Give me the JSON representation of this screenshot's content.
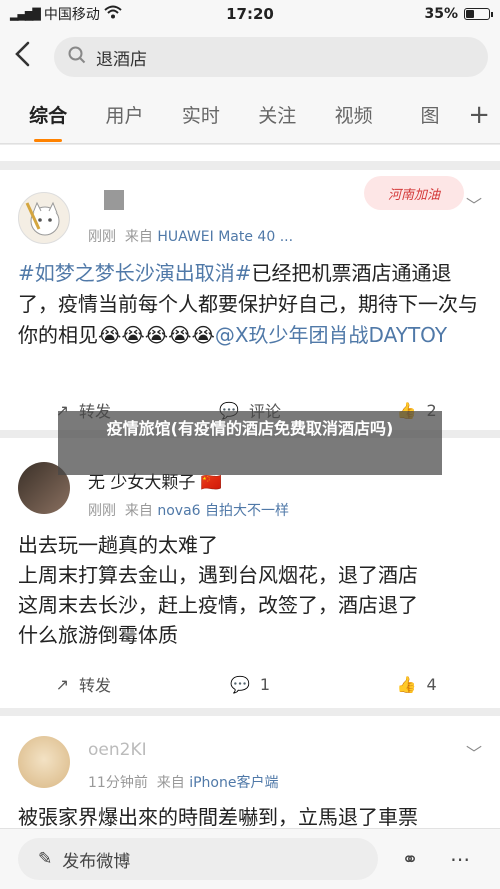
{
  "status_bar": {
    "carrier": "中国移动",
    "time": "17:20",
    "battery": "35%",
    "battery_level": 0.35
  },
  "search": {
    "query": "退酒店"
  },
  "tabs": [
    {
      "label": "综合",
      "active": true
    },
    {
      "label": "用户",
      "active": false
    },
    {
      "label": "实时",
      "active": false
    },
    {
      "label": "关注",
      "active": false
    },
    {
      "label": "视频",
      "active": false
    },
    {
      "label": "图",
      "active": false
    }
  ],
  "posts": [
    {
      "time": "刚刚",
      "source_prefix": "来自",
      "source": "HUAWEI Mate 40 ...",
      "topic": "#如梦之梦长沙演出取消#",
      "text": "已经把机票酒店通通退了，疫情当前每个人都要保护好自己，期待下一次与你的相见",
      "emoji": "😭😭😭😭😭",
      "mention": "@X玖少年团肖战DAYTOY",
      "badge": "河南加油",
      "repost": "转发",
      "comment": "评论",
      "like": "2"
    },
    {
      "username": "无 少女大颗子",
      "flag": "🇨🇳",
      "time": "刚刚",
      "source_prefix": "来自",
      "source": "nova6 自拍大不一样",
      "lines": [
        "出去玩一趟真的太难了",
        "上周末打算去金山，遇到台风烟花，退了酒店",
        "这周末去长沙，赶上疫情，改签了，酒店退了",
        "什么旅游倒霉体质"
      ],
      "repost": "转发",
      "comment": "1",
      "like": "4"
    },
    {
      "username": "oen2KI",
      "time": "11分钟前",
      "source_prefix": "来自",
      "source": "iPhone客户端",
      "text": "被張家界爆出來的時間差嚇到，立馬退了車票"
    }
  ],
  "overlay": {
    "title": "疫情旅馆(有疫情的酒店免费取消酒店吗)"
  },
  "bottom_bar": {
    "post_label": "发布微博"
  }
}
